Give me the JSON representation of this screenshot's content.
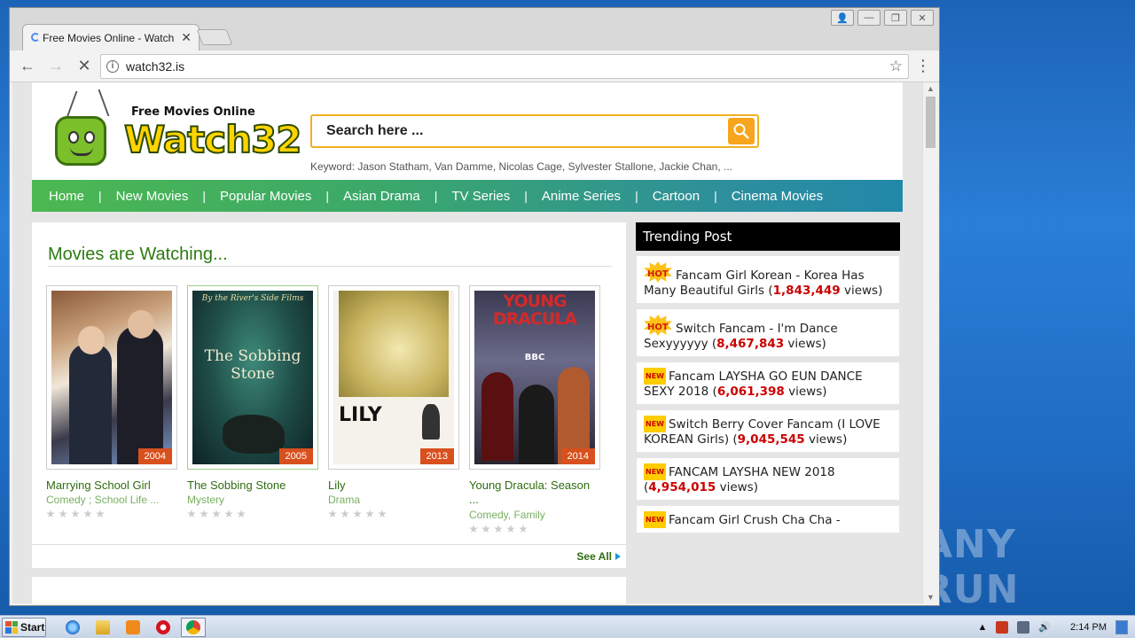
{
  "desktop": {
    "watermark": "ANY RUN"
  },
  "browser": {
    "tab_title": "Free Movies Online - Watch",
    "url": "watch32.is",
    "window_buttons": [
      "person",
      "minimize",
      "restore",
      "close"
    ]
  },
  "site": {
    "logo_tagline": "Free Movies Online",
    "logo_word": "Watch32",
    "search_placeholder": "Search here ...",
    "keywords": "Keyword: Jason Statham, Van Damme, Nicolas Cage, Sylvester Stallone, Jackie Chan, ...",
    "nav": [
      "Home",
      "New Movies",
      "Popular Movies",
      "Asian Drama",
      "TV Series",
      "Anime Series",
      "Cartoon",
      "Cinema Movies"
    ],
    "nav_separator": "|",
    "section_title": "Movies are Watching...",
    "see_all": "See All",
    "movies": [
      {
        "title": "Marrying School Girl",
        "genre": "Comedy ; School Life ...",
        "year": "2004",
        "rating": 0
      },
      {
        "title": "The Sobbing Stone",
        "genre": "Mystery",
        "year": "2005",
        "rating": 0,
        "poster_heading": "By the River's Side Films",
        "poster_title": "The Sobbing Stone"
      },
      {
        "title": "Lily",
        "genre": "Drama",
        "year": "2013",
        "rating": 0,
        "poster_title": "LILY"
      },
      {
        "title": "Young Dracula: Season ...",
        "genre": "Comedy, Family",
        "year": "2014",
        "rating": 0,
        "poster_title": "YOUNG DRACULA",
        "poster_badge": "BBC"
      }
    ],
    "trending": {
      "header": "Trending Post",
      "items": [
        {
          "badge": "HOT",
          "text": "Fancam Girl Korean - Korea Has Many Beautiful Girls (",
          "views": "1,843,449",
          "suffix": " views)"
        },
        {
          "badge": "HOT",
          "text": "Switch Fancam - I'm Dance Sexyyyyyy (",
          "views": "8,467,843",
          "suffix": " views)"
        },
        {
          "badge": "NEW",
          "text": "Fancam LAYSHA GO EUN DANCE SEXY 2018 (",
          "views": "6,061,398",
          "suffix": " views)"
        },
        {
          "badge": "NEW",
          "text": "Switch Berry Cover Fancam (I LOVE KOREAN Girls) (",
          "views": "9,045,545",
          "suffix": " views)"
        },
        {
          "badge": "NEW",
          "text": "FANCAM LAYSHA NEW 2018 (",
          "views": "4,954,015",
          "suffix": " views)"
        },
        {
          "badge": "NEW",
          "text": "Fancam Girl Crush Cha Cha -",
          "views": "",
          "suffix": ""
        }
      ]
    }
  },
  "taskbar": {
    "start_label": "Start",
    "clock": "2:14 PM",
    "apps": [
      "internet-explorer",
      "file-explorer",
      "media-player",
      "opera",
      "chrome"
    ]
  },
  "colors": {
    "nav_green": "#4cb851",
    "title_green": "#2f7a12",
    "views_red": "#cc0000",
    "search_orange": "#f7a51c",
    "year_badge": "#d8501e"
  }
}
